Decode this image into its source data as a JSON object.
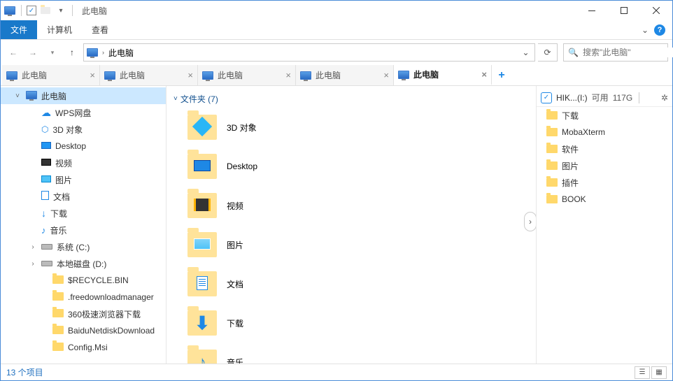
{
  "window": {
    "title": "此电脑"
  },
  "ribbon": {
    "file": "文件",
    "computer": "计算机",
    "view": "查看"
  },
  "address": {
    "location": "此电脑"
  },
  "search": {
    "placeholder": "搜索\"此电脑\""
  },
  "tabs": [
    {
      "label": "此电脑",
      "active": false
    },
    {
      "label": "此电脑",
      "active": false
    },
    {
      "label": "此电脑",
      "active": false
    },
    {
      "label": "此电脑",
      "active": false
    },
    {
      "label": "此电脑",
      "active": true
    }
  ],
  "nav_pane": [
    {
      "label": "此电脑",
      "type": "pc",
      "selected": true,
      "level": 0
    },
    {
      "label": "WPS网盘",
      "type": "wps",
      "level": 1
    },
    {
      "label": "3D 对象",
      "type": "3d",
      "level": 1
    },
    {
      "label": "Desktop",
      "type": "desktop",
      "level": 1
    },
    {
      "label": "视频",
      "type": "video",
      "level": 1
    },
    {
      "label": "图片",
      "type": "pictures",
      "level": 1
    },
    {
      "label": "文档",
      "type": "docs",
      "level": 1
    },
    {
      "label": "下载",
      "type": "downloads",
      "level": 1
    },
    {
      "label": "音乐",
      "type": "music",
      "level": 1
    },
    {
      "label": "系统 (C:)",
      "type": "drive",
      "level": 1,
      "expandable": true
    },
    {
      "label": "本地磁盘 (D:)",
      "type": "drive",
      "level": 1,
      "expandable": true
    },
    {
      "label": "$RECYCLE.BIN",
      "type": "folder",
      "level": 2
    },
    {
      "label": ".freedownloadmanager",
      "type": "folder",
      "level": 2
    },
    {
      "label": "360极速浏览器下载",
      "type": "folder",
      "level": 2
    },
    {
      "label": "BaiduNetdiskDownload",
      "type": "folder",
      "level": 2
    },
    {
      "label": "Config.Msi",
      "type": "folder",
      "level": 2
    }
  ],
  "main": {
    "section_header": "文件夹 (7)",
    "items": [
      {
        "label": "3D 对象",
        "icon": "3d"
      },
      {
        "label": "Desktop",
        "icon": "desktop"
      },
      {
        "label": "视频",
        "icon": "video"
      },
      {
        "label": "图片",
        "icon": "pictures"
      },
      {
        "label": "文档",
        "icon": "docs"
      },
      {
        "label": "下载",
        "icon": "downloads"
      },
      {
        "label": "音乐",
        "icon": "music"
      }
    ]
  },
  "preview": {
    "drive_label": "HIK...(I:)",
    "drive_free_label": "可用",
    "drive_free": "117G",
    "items": [
      {
        "label": "下载"
      },
      {
        "label": "MobaXterm"
      },
      {
        "label": "软件"
      },
      {
        "label": "图片"
      },
      {
        "label": "插件"
      },
      {
        "label": "BOOK"
      }
    ]
  },
  "status": {
    "text": "13 个项目"
  }
}
